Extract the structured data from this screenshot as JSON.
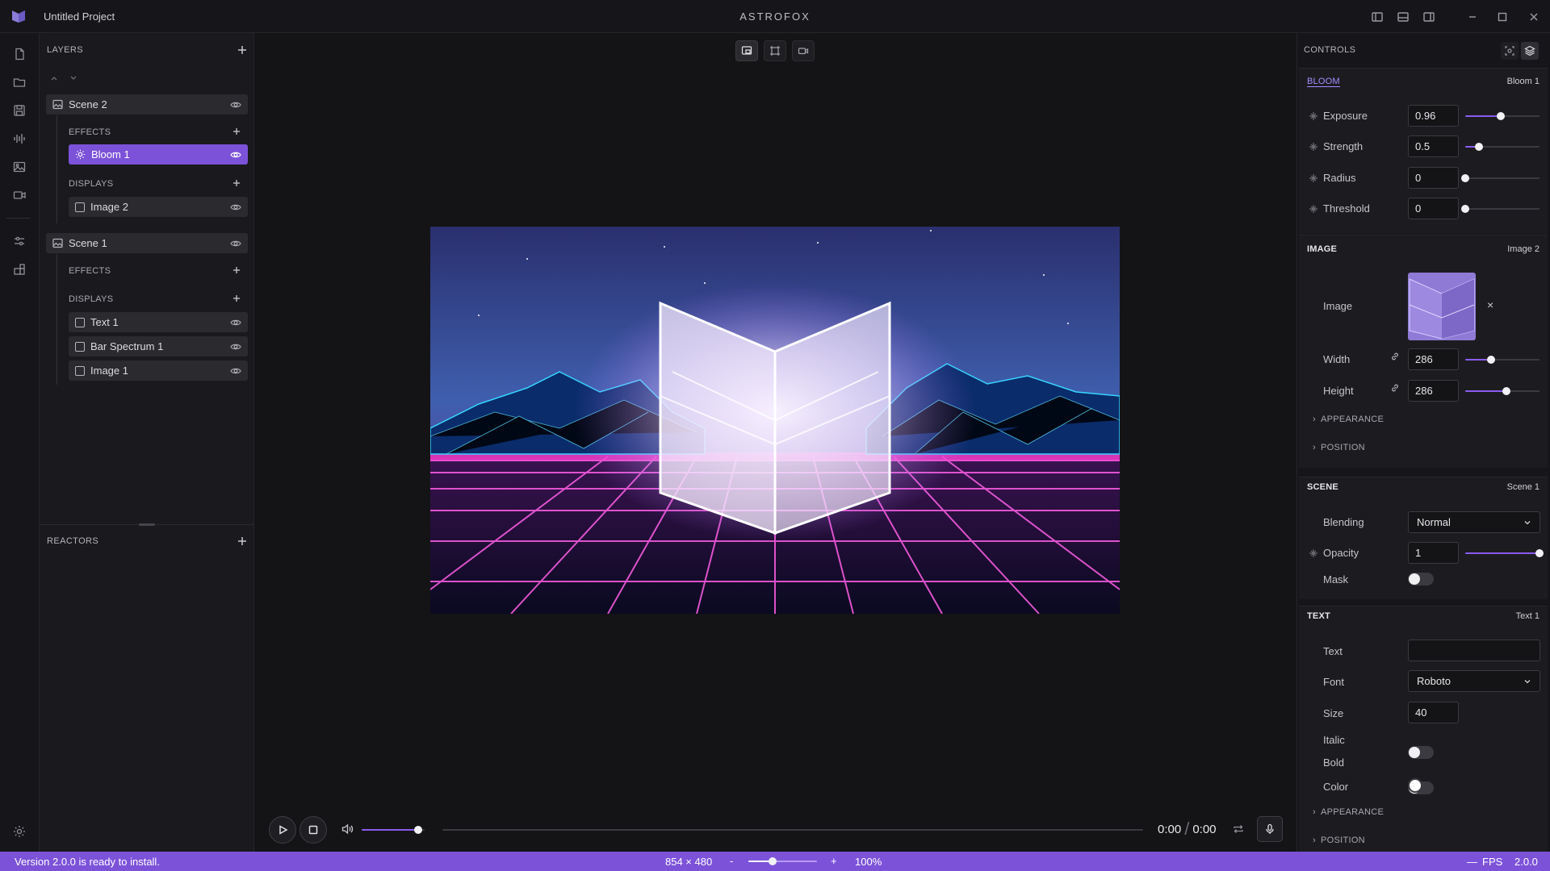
{
  "titlebar": {
    "project": "Untitled Project",
    "app": "ASTROFOX"
  },
  "layers": {
    "heading": "LAYERS",
    "scenes": [
      {
        "name": "Scene 2",
        "effects_label": "EFFECTS",
        "displays_label": "DISPLAYS",
        "effects": [
          "Bloom 1"
        ],
        "displays": [
          "Image 2"
        ]
      },
      {
        "name": "Scene 1",
        "effects_label": "EFFECTS",
        "displays_label": "DISPLAYS",
        "effects": [],
        "displays": [
          "Text 1",
          "Bar Spectrum 1",
          "Image 1"
        ]
      }
    ],
    "reactors_heading": "REACTORS"
  },
  "player": {
    "volume": 0.9,
    "progress": 0.0,
    "time_current": "0:00",
    "time_separator": "/",
    "time_total": "0:00"
  },
  "controls": {
    "heading": "CONTROLS",
    "bloom": {
      "title": "BLOOM",
      "name": "Bloom 1",
      "fields": [
        {
          "label": "Exposure",
          "value": "0.96",
          "level": 0.48
        },
        {
          "label": "Strength",
          "value": "0.5",
          "level": 0.19
        },
        {
          "label": "Radius",
          "value": "0",
          "level": 0.0
        },
        {
          "label": "Threshold",
          "value": "0",
          "level": 0.0
        }
      ]
    },
    "image": {
      "title": "IMAGE",
      "name": "Image 2",
      "image_label": "Image",
      "remove": "×",
      "width_label": "Width",
      "width_value": "286",
      "width_level": 0.35,
      "height_label": "Height",
      "height_value": "286",
      "height_level": 0.55,
      "appearance": "APPEARANCE",
      "position": "POSITION"
    },
    "scene": {
      "title": "SCENE",
      "name": "Scene 1",
      "blending_label": "Blending",
      "blending_value": "Normal",
      "opacity_label": "Opacity",
      "opacity_value": "1",
      "opacity_level": 1.0,
      "mask_label": "Mask"
    },
    "text": {
      "title": "TEXT",
      "name": "Text 1",
      "text_label": "Text",
      "text_value": "",
      "font_label": "Font",
      "font_value": "Roboto",
      "size_label": "Size",
      "size_value": "40",
      "italic_label": "Italic",
      "bold_label": "Bold",
      "color_label": "Color",
      "appearance": "APPEARANCE",
      "position": "POSITION"
    }
  },
  "statusbar": {
    "message": "Version 2.0.0 is ready to install.",
    "resolution": "854 × 480",
    "zoom_minus": "-",
    "zoom_plus": "+",
    "zoom_level": 0.35,
    "zoom": "100%",
    "fps_dash": "—",
    "fps_label": "FPS",
    "version": "2.0.0"
  },
  "colors": {
    "accent": "#7c52d9",
    "slider_fill": "#8a5cf0",
    "background": "#141416"
  }
}
